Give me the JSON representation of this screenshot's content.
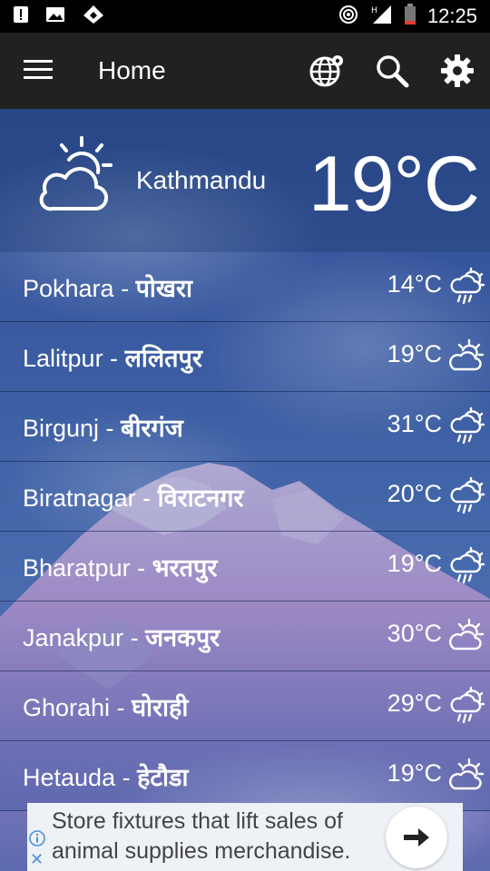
{
  "status_bar": {
    "time": "12:25",
    "icons": [
      "alert-icon",
      "image-icon",
      "vpn-icon",
      "hotspot-icon",
      "signal-icon",
      "battery-icon"
    ],
    "network": "H"
  },
  "app_bar": {
    "title": "Home",
    "icons": [
      "menu-icon",
      "globe-icon",
      "search-icon",
      "settings-icon"
    ]
  },
  "current": {
    "city": "Kathmandu",
    "temp": "19°C",
    "icon": "partly-cloudy-icon"
  },
  "cities": [
    {
      "name": "Pokhara - ",
      "name_np": "पोखरा",
      "temp": "14°C",
      "icon": "rain-icon"
    },
    {
      "name": "Lalitpur - ",
      "name_np": "ललितपुर",
      "temp": "19°C",
      "icon": "partly-cloudy-icon"
    },
    {
      "name": "Birgunj - ",
      "name_np": "बीरगंज",
      "temp": "31°C",
      "icon": "rain-icon"
    },
    {
      "name": "Biratnagar - ",
      "name_np": "विराटनगर",
      "temp": "20°C",
      "icon": "rain-icon"
    },
    {
      "name": "Bharatpur - ",
      "name_np": "भरतपुर",
      "temp": "19°C",
      "icon": "rain-icon"
    },
    {
      "name": "Janakpur - ",
      "name_np": "जनकपुर",
      "temp": "30°C",
      "icon": "partly-cloudy-icon"
    },
    {
      "name": "Ghorahi - ",
      "name_np": "घोराही",
      "temp": "29°C",
      "icon": "rain-icon"
    },
    {
      "name": "Hetauda - ",
      "name_np": "हेटौडा",
      "temp": "19°C",
      "icon": "partly-cloudy-icon"
    }
  ],
  "ad": {
    "text": "Store fixtures that lift sales of animal supplies merchandise.",
    "close_label": "✕"
  },
  "colors": {
    "status_bar": "#000000",
    "app_bar": "#212121",
    "ad_background": "#eef1f6",
    "ad_icon": "#4a90d9"
  }
}
